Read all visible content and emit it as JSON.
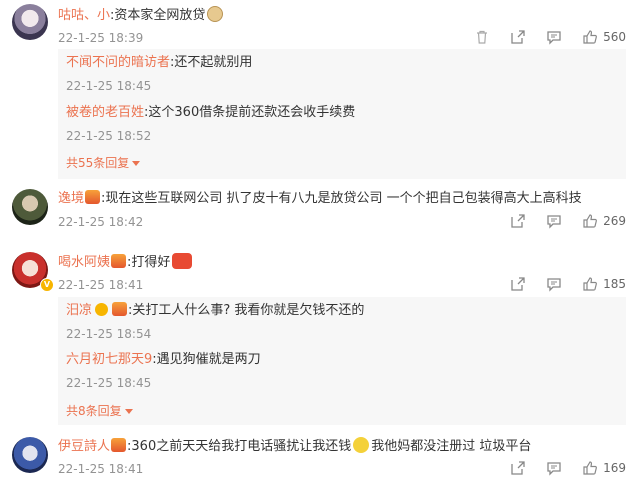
{
  "comments": [
    {
      "name": "咕咕、小",
      "text": ":资本家全网放贷",
      "time": "22-1-25 18:39",
      "likes": "560",
      "replies": [
        {
          "name": "不闻不问的暗访者",
          "text": ":还不起就别用",
          "time": "22-1-25 18:45"
        },
        {
          "name": "被卷的老百姓",
          "text": ":这个360借条提前还款还会收手续费",
          "time": "22-1-25 18:52"
        }
      ],
      "more": "共55条回复"
    },
    {
      "name": "逸境",
      "text": ":现在这些互联网公司 扒了皮十有八九是放贷公司 一个个把自己包装得高大上高科技",
      "time": "22-1-25 18:42",
      "likes": "269"
    },
    {
      "name": "喝水阿姨",
      "text": ":打得好",
      "time": "22-1-25 18:41",
      "likes": "185",
      "replies": [
        {
          "name": "汨凉",
          "text": ":关打工人什么事? 我看你就是欠钱不还的",
          "time": "22-1-25 18:54"
        },
        {
          "name": "六月初七那天9",
          "text": ":遇见狗催就是两刀",
          "time": "22-1-25 18:45"
        }
      ],
      "more": "共8条回复"
    },
    {
      "name": "伊豆詩人",
      "text": ":360之前天天给我打电话骚扰让我还钱",
      "text2": "我他妈都没注册过 垃圾平台",
      "time": "22-1-25 18:41",
      "likes": "169"
    }
  ],
  "icons": {
    "delete": "trash-icon",
    "share": "share-icon",
    "comment": "comment-icon",
    "like": "thumbs-up-icon"
  }
}
